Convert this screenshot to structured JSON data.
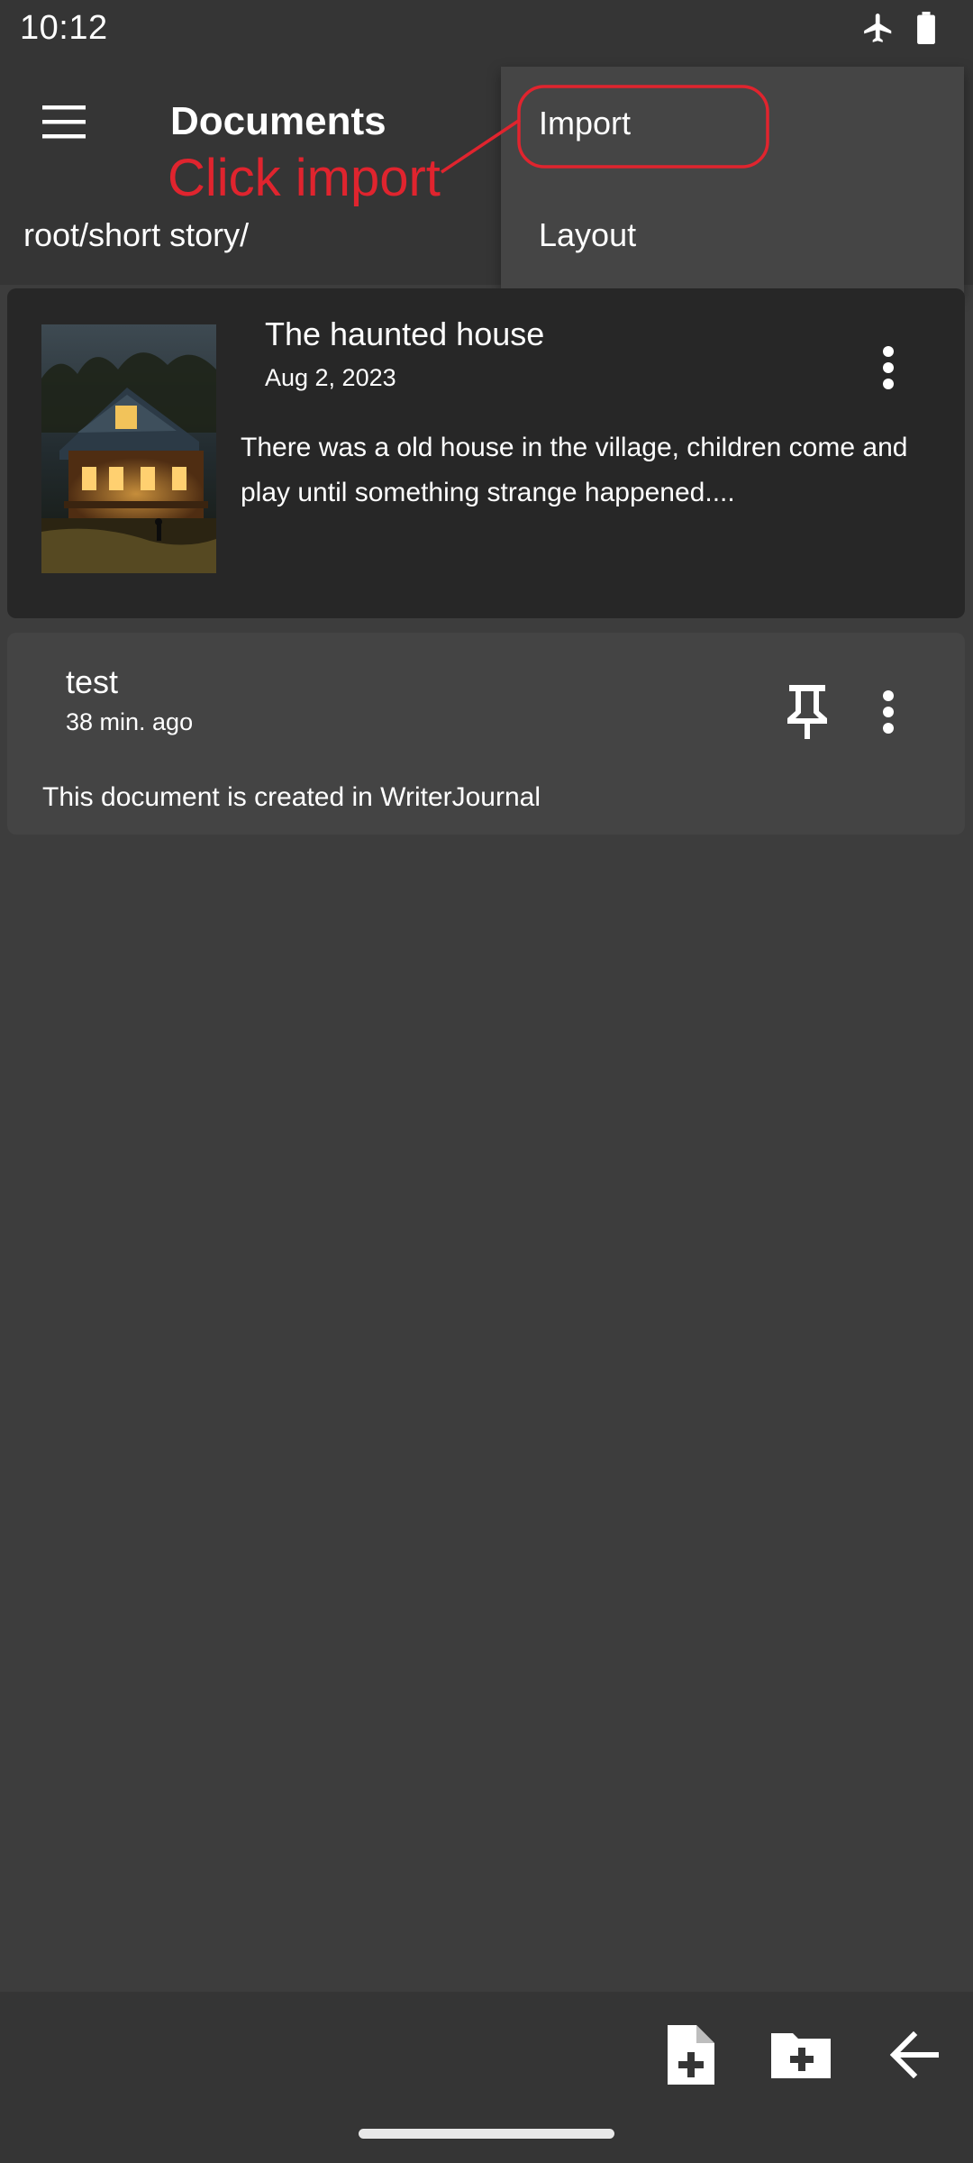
{
  "status_bar": {
    "time": "10:12",
    "icons": [
      "airplane-mode-icon",
      "battery-icon"
    ]
  },
  "app_bar": {
    "title": "Documents",
    "breadcrumb": "root/short story/",
    "menu_icon": "hamburger-menu-icon"
  },
  "overflow_menu": {
    "items": [
      {
        "label": "Import"
      },
      {
        "label": "Layout"
      }
    ]
  },
  "annotation": {
    "text": "Click import",
    "color": "#e0242e"
  },
  "documents": [
    {
      "title": "The haunted house",
      "date": "Aug 2, 2023",
      "description": "There was a old house in the village, children come and play until something strange happened....",
      "has_thumbnail": true,
      "pinned": false
    },
    {
      "title": "test",
      "date": "38 min. ago",
      "description": "This document is created in WriterJournal",
      "has_thumbnail": false,
      "pinned": true
    }
  ],
  "bottom_bar": {
    "actions": [
      "new-document-icon",
      "new-folder-icon",
      "back-arrow-icon"
    ]
  },
  "colors": {
    "background": "#3d3d3d",
    "bar": "#353535",
    "card_selected": "#272727",
    "card": "#444444",
    "menu": "#454545"
  }
}
